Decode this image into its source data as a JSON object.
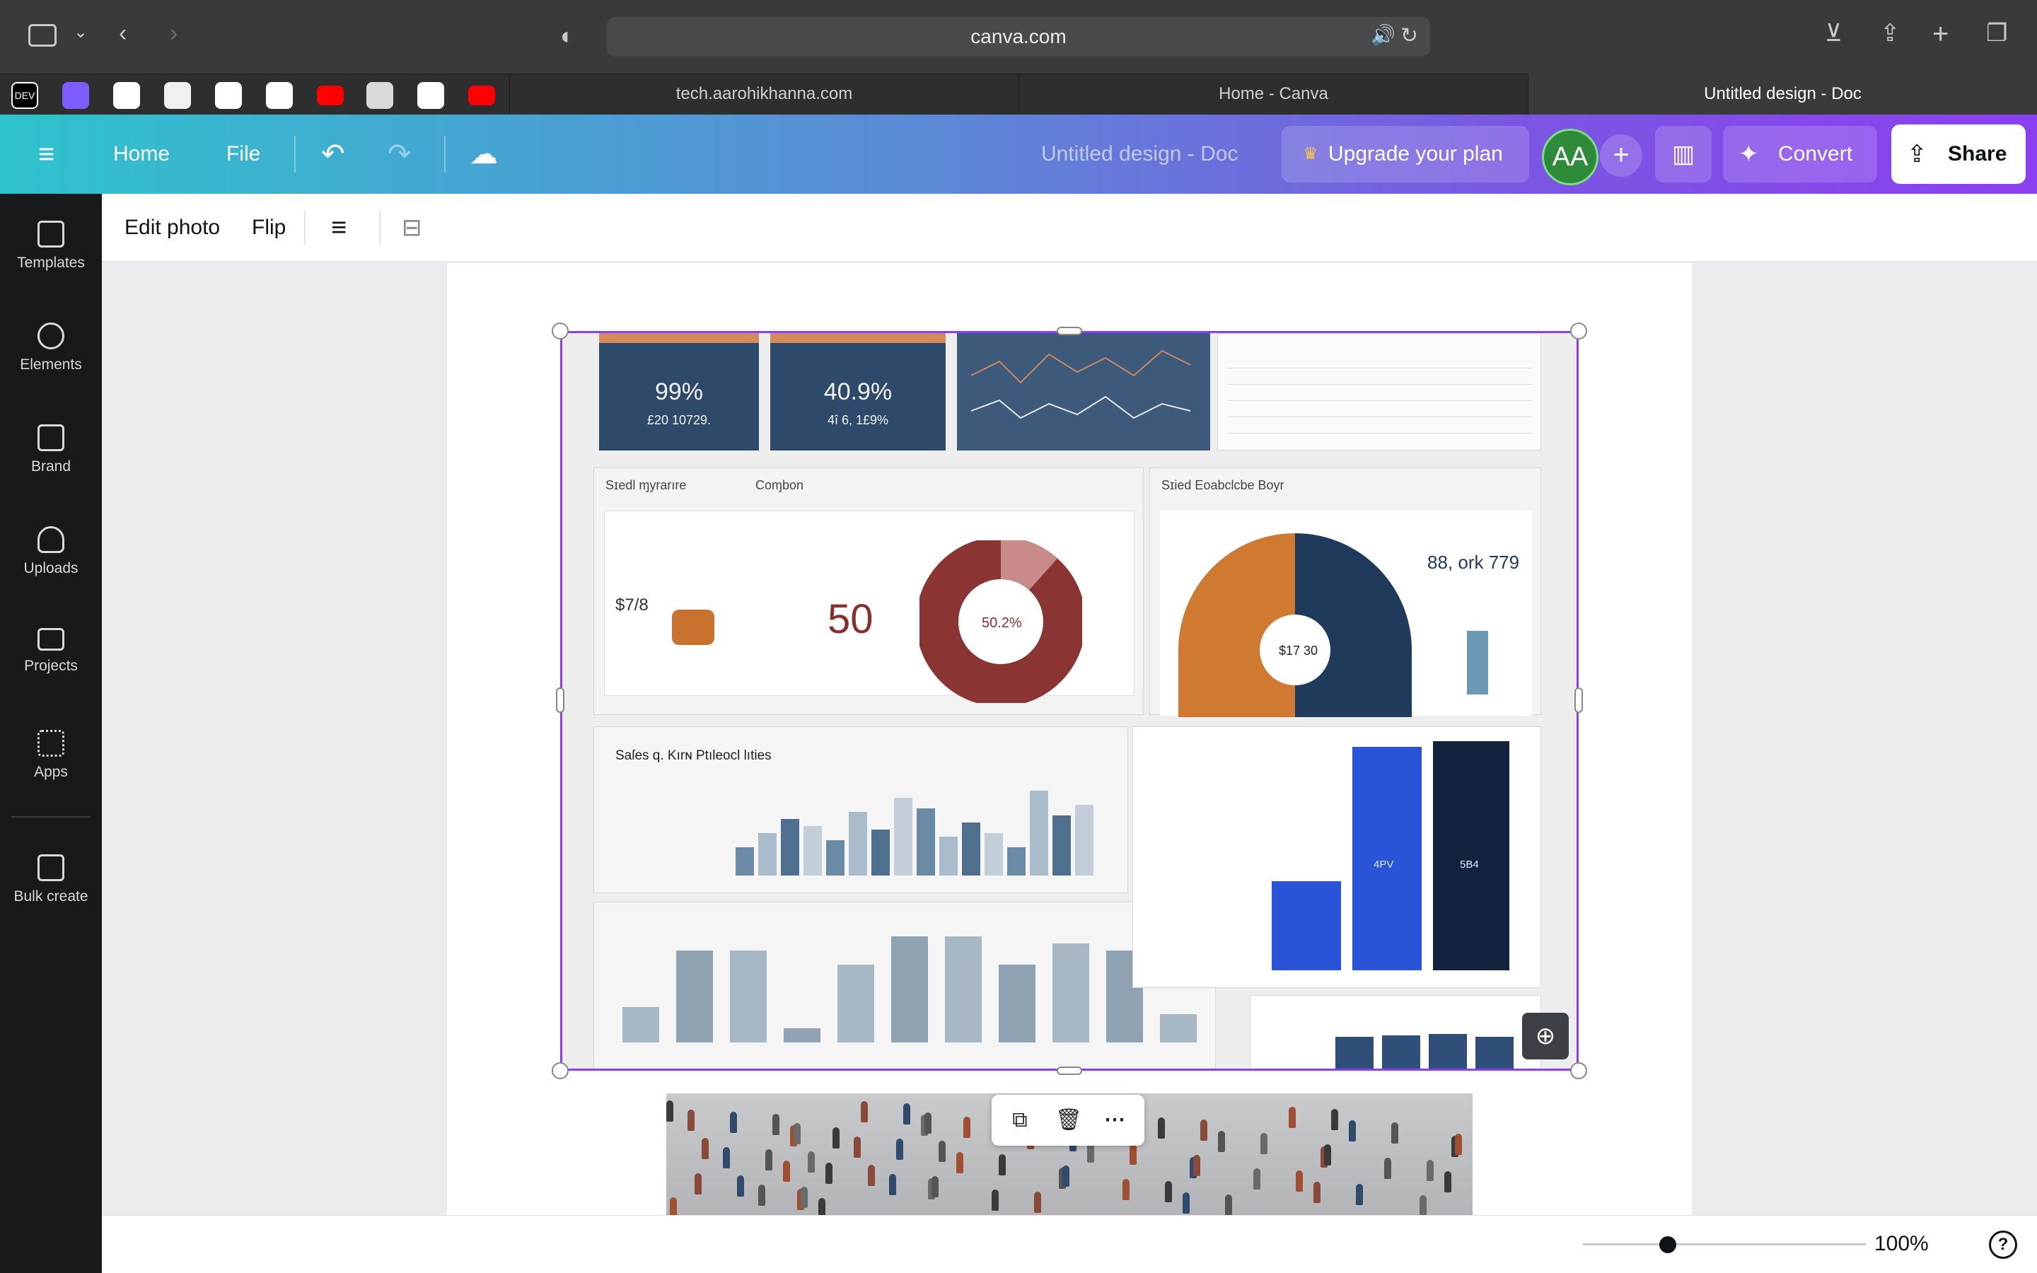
{
  "browser": {
    "url": "canva.com",
    "tabs": [
      {
        "label": "tech.aarohikhanna.com",
        "active": false
      },
      {
        "label": "Home - Canva",
        "active": false
      },
      {
        "label": "Untitled design - Doc",
        "active": true
      }
    ],
    "pinned_favicons": [
      "dev-icon",
      "podcast-icon",
      "github-icon",
      "notion-icon",
      "openai-icon",
      "github-icon",
      "youtube-icon",
      "app-icon",
      "github-icon",
      "youtube-icon"
    ]
  },
  "header": {
    "home": "Home",
    "file": "File",
    "doc_title": "Untitled design - Doc",
    "upgrade": "Upgrade your plan",
    "avatar_initials": "AA",
    "convert": "Convert",
    "share": "Share"
  },
  "sidebar": {
    "items": [
      {
        "label": "Templates",
        "icon": "templates-icon"
      },
      {
        "label": "Elements",
        "icon": "elements-icon"
      },
      {
        "label": "Brand",
        "icon": "brand-icon"
      },
      {
        "label": "Uploads",
        "icon": "uploads-icon"
      },
      {
        "label": "Projects",
        "icon": "projects-icon"
      },
      {
        "label": "Apps",
        "icon": "apps-icon"
      },
      {
        "label": "Bulk create",
        "icon": "bulk-create-icon"
      }
    ]
  },
  "context_toolbar": {
    "edit_photo": "Edit photo",
    "flip": "Flip"
  },
  "dashboard_image": {
    "card1_value": "99%",
    "card1_sub": "£20 10729.",
    "card2_value": "40.9%",
    "card2_sub": "4î 6, 1£9%",
    "panel_a_title": "Sɪedl ɱyrarıre",
    "panel_a_tab": "Coɱbon",
    "big_number": "50",
    "small_value": "$7/8",
    "donut_center": "50.2%",
    "panel_b_title": "Sɪied Eoabclcbe Boyr",
    "right_value": "88, ork 779",
    "donut2_center": "$17 30",
    "bar_chart_title": "Saſes q. Kırɴ Ptıleocl lıties",
    "bar_label_1": "4PV",
    "bar_label_2": "5B4"
  },
  "bottom": {
    "zoom": "100%",
    "zoom_fraction": 0.27
  },
  "colors": {
    "accent": "#8b3dff",
    "header_start": "#2ec3cd",
    "header_end": "#8b3ff0"
  }
}
